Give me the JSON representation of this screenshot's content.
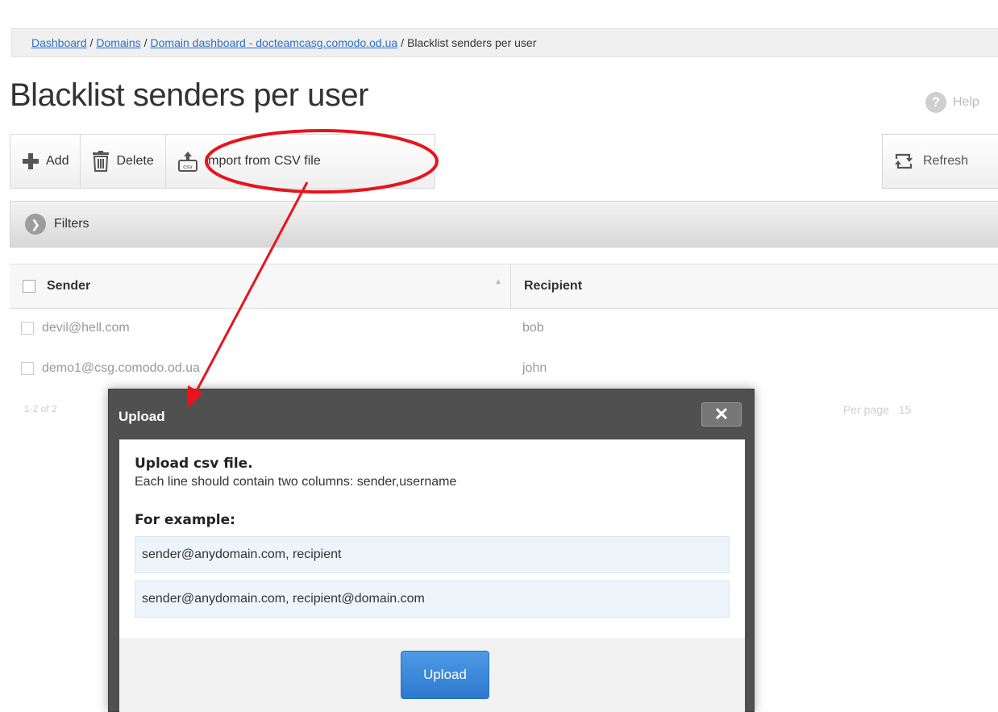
{
  "breadcrumb": {
    "items": [
      {
        "label": "Dashboard"
      },
      {
        "label": "Domains"
      },
      {
        "label": "Domain dashboard - docteamcasg.comodo.od.ua"
      }
    ],
    "current": "Blacklist senders per user",
    "separator": "/"
  },
  "page": {
    "title": "Blacklist senders per user",
    "help_label": "Help"
  },
  "toolbar": {
    "add_label": "Add",
    "delete_label": "Delete",
    "import_label": "Import from CSV file",
    "refresh_label": "Refresh"
  },
  "filters": {
    "label": "Filters"
  },
  "table": {
    "columns": [
      "Sender",
      "Recipient"
    ],
    "rows": [
      {
        "sender": "devil@hell.com",
        "recipient": "bob"
      },
      {
        "sender": "demo1@csg.comodo.od.ua",
        "recipient": "john"
      }
    ]
  },
  "pager": {
    "info": "1-2 of 2",
    "per_page_label": "Per page",
    "per_page_value": "15"
  },
  "modal": {
    "title": "Upload",
    "close_label": "✕",
    "heading": "Upload csv file.",
    "description": "Each line should contain two columns: sender,username",
    "example_heading": "For example:",
    "examples": [
      "sender@anydomain.com, recipient",
      "sender@anydomain.com, recipient@domain.com"
    ],
    "upload_button": "Upload"
  },
  "colors": {
    "link": "#2a6fc9",
    "annotation": "#e8141c",
    "primary_button": "#3a87d8"
  }
}
